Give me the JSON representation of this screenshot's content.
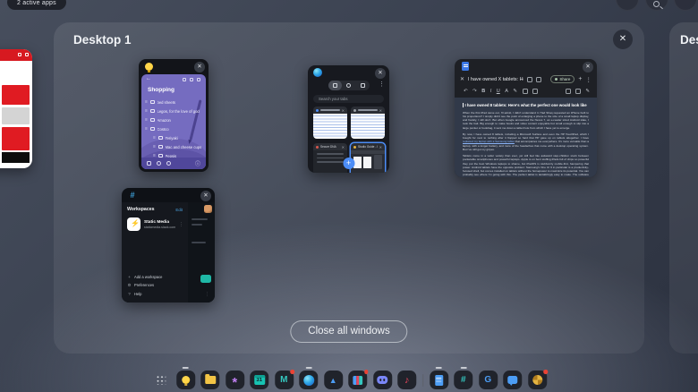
{
  "status_bar": {
    "active_apps_label": "2 active apps"
  },
  "overview": {
    "desktop1_title": "Desktop 1",
    "desktop2_visible_title": "Des",
    "close_all_label": "Close all windows"
  },
  "glyphs": {
    "close": "✕",
    "more_vertical": "⋮",
    "back": "←",
    "plus": "+",
    "drag_handle": "≡",
    "undo": "↶",
    "redo": "↷",
    "bold": "B",
    "italic": "I",
    "underline": "U",
    "text_color": "A",
    "pen": "✎",
    "music_note": "♪",
    "drive_triangle": "▲",
    "asterisk": "✳",
    "slack_hash": "#",
    "google_g": "G",
    "gmail_m": "M",
    "question": "?",
    "gear": "⚙",
    "info": "ⓘ",
    "bolt": "⚡"
  },
  "keep_window": {
    "app": "Google Keep",
    "note_title": "Shopping",
    "items": [
      {
        "text": "bed sheets"
      },
      {
        "text": "Legos, for the love of god"
      },
      {
        "text": "Amazon"
      },
      {
        "text": "Costco"
      },
      {
        "text": "Teriyaki"
      },
      {
        "text": "Mac and cheese cups"
      },
      {
        "text": "Pepsis"
      }
    ]
  },
  "browser_window": {
    "app": "Microsoft Edge",
    "search_placeholder": "Search your tabs",
    "tabs": [
      {
        "title": ""
      },
      {
        "title": ""
      },
      {
        "title": "Secure DNA"
      },
      {
        "title": "Studio Guide - Uproar"
      }
    ]
  },
  "docs_window": {
    "app": "Google Docs",
    "doc_title": "I have owned X tablets: Here's what the p...",
    "share_label": "Share",
    "heading": "I have owned 8 tablets: Here's what the perfect one would look like",
    "paragraph1": "When the first iPad came out, I'll admit, I didn't understand it. Had Shaq requested an iPhone built to his proportions? I simply didn't see the point of enlarging a phone to the size of a small laptop display, and frankly, I still don't. But when Google announced the Nexus 7, an e-reader sized Android slate, I took the bait. Big enough to make books and video content enjoyable but small enough to slip into a large pocket or bookbag, it sent me down a tablet hole from which I have yet to emerge.",
    "paragraph2_before_link": "By now, I have owned 8 tablets, including a Microsoft Surface and even the HP TouchPad, which I bought for next to nothing after it flopped so hard that HP gave up on tablets altogether. I have ",
    "paragraph2_link": "replaced my laptop with a Samsung tablet",
    "paragraph2_after_link": " that accompanies me everywhere. It's more versatile than a laptop, with a longer battery, and more of the headaches that come with a desktop operating system. But I've still got my gripes.",
    "paragraph3": "Tablets come in a wider variety than ever, yet still feel like awkward step-children stuck between pocketable smartphones and powerful laptops. Apple is on bent stuffing iPads full of chips so powerful they put the best Windows laptops to shame, but iPadOS is stubbornly mobile-first, hampering that power. Android tablets have the opposite problem: Samsung's One UI 6 in particular is a productivity-focused shell, but comes installed on tablets without the horsepower to maximize its potential. You can probably see where I'm going with this. The perfect tablet is tantalizingly easy to make. The software and hardware just need to be in alignment. Here's how that could happen."
  },
  "slack_window": {
    "app": "Slack",
    "header": "Workspaces",
    "edit_label": "Edit",
    "workspace_name": "Static Media",
    "workspace_url": "staticmedia.slack.com",
    "menu": [
      {
        "label": "Add a workspace"
      },
      {
        "label": "Preferences"
      },
      {
        "label": "Help"
      }
    ]
  },
  "dock": {
    "apps": [
      {
        "name": "app-drawer"
      },
      {
        "name": "keep",
        "running": true
      },
      {
        "name": "files"
      },
      {
        "name": "asterisk-app"
      },
      {
        "name": "calendar",
        "label": "31"
      },
      {
        "name": "gmail",
        "badge": true
      },
      {
        "name": "edge",
        "running": true
      },
      {
        "name": "drive"
      },
      {
        "name": "wallet",
        "badge": true
      },
      {
        "name": "discord"
      },
      {
        "name": "music"
      },
      {
        "name": "docs",
        "running": true
      },
      {
        "name": "slack",
        "running": true
      },
      {
        "name": "google"
      },
      {
        "name": "chat"
      },
      {
        "name": "photos",
        "badge": true
      }
    ]
  },
  "colors": {
    "keep_note_purple": "#756cc0",
    "selected_tab_blue": "#4c8df6",
    "docs_link_blue": "#8ab4f8",
    "badge_red": "#ea4335",
    "edge_blue": "#2fa8e8",
    "slack_teal": "#35c8c0",
    "close_all_border": "#dadee4",
    "red_window_red": "#d71920"
  }
}
